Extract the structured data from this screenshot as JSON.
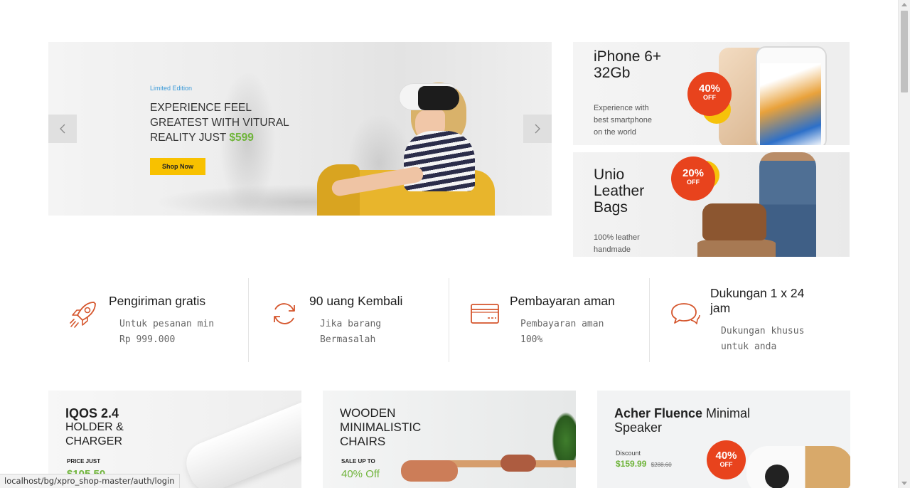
{
  "hero": {
    "eyebrow": "Limited Edition",
    "headline_line1": "EXPERIENCE FEEL",
    "headline_line2": "GREATEST WITH VITURAL",
    "headline_line3": "REALITY JUST ",
    "price": "$599",
    "cta": "Shop Now",
    "prev_icon": "chevron-left-icon",
    "next_icon": "chevron-right-icon"
  },
  "promos": [
    {
      "title_line1": "iPhone 6+",
      "title_line2": "32Gb",
      "desc_line1": "Experience with",
      "desc_line2": "best smartphone",
      "desc_line3": "on the world",
      "badge_pct": "40%",
      "badge_off": "OFF"
    },
    {
      "title_line1": "Unio",
      "title_line2": "Leather",
      "title_line3": "Bags",
      "desc_line1": "100% leather",
      "desc_line2": "handmade",
      "badge_pct": "20%",
      "badge_off": "OFF"
    }
  ],
  "features": [
    {
      "icon": "rocket-icon",
      "title": "Pengiriman gratis",
      "desc_line1": "Untuk pesanan min",
      "desc_line2": "Rp 999.000"
    },
    {
      "icon": "refresh-icon",
      "title": "90 uang Kembali",
      "desc_line1": "Jika barang",
      "desc_line2": "Bermasalah"
    },
    {
      "icon": "credit-card-icon",
      "title": "Pembayaran aman",
      "desc_line1": "Pembayaran aman",
      "desc_line2": "100%"
    },
    {
      "icon": "chat-bubbles-icon",
      "title_line1": "Dukungan 1 x 24",
      "title_line2": "jam",
      "desc_line1": "Dukungan khusus",
      "desc_line2": "untuk anda"
    }
  ],
  "cards": [
    {
      "title_bold": "IQOS 2.4",
      "title_line2": "HOLDER &",
      "title_line3": "CHARGER",
      "small": "PRICE JUST",
      "price": "$105.50"
    },
    {
      "title_line1": "WOODEN",
      "title_line2": "MINIMALISTIC",
      "title_line3": "CHAIRS",
      "small": "SALE UP TO",
      "price": "40% Off"
    },
    {
      "title_bold": "Acher Fluence",
      "title_rest": " Minimal",
      "title_line2": "Speaker",
      "small": "Discount",
      "price": "$159.99",
      "old_price": "$288.60",
      "badge_pct": "40%",
      "badge_off": "OFF"
    }
  ],
  "status_url": "localhost/bg/xpro_shop-master/auth/login",
  "colors": {
    "accent_orange": "#e8431d",
    "price_green": "#6fb43a",
    "cta_yellow": "#f8c100",
    "eyebrow_blue": "#3b9ad8",
    "icon_orange": "#d5562d"
  }
}
